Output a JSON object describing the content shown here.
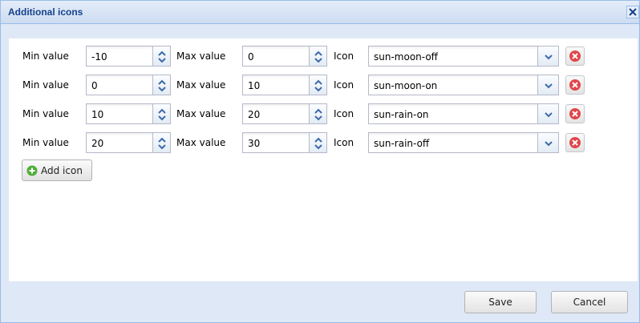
{
  "window": {
    "title": "Additional icons",
    "close_icon": "close-icon"
  },
  "labels": {
    "min": "Min value",
    "max": "Max value",
    "icon": "Icon"
  },
  "rows": [
    {
      "min": "-10",
      "max": "0",
      "icon": "sun-moon-off"
    },
    {
      "min": "0",
      "max": "10",
      "icon": "sun-moon-on"
    },
    {
      "min": "10",
      "max": "20",
      "icon": "sun-rain-on"
    },
    {
      "min": "20",
      "max": "30",
      "icon": "sun-rain-off"
    }
  ],
  "add_button": {
    "label": "Add icon",
    "icon": "plus-circle-icon"
  },
  "footer": {
    "save": "Save",
    "cancel": "Cancel"
  },
  "colors": {
    "title_text": "#15428b",
    "window_bg": "#dfe8f6",
    "remove_red": "#e0464a",
    "add_green": "#4fae3a"
  }
}
